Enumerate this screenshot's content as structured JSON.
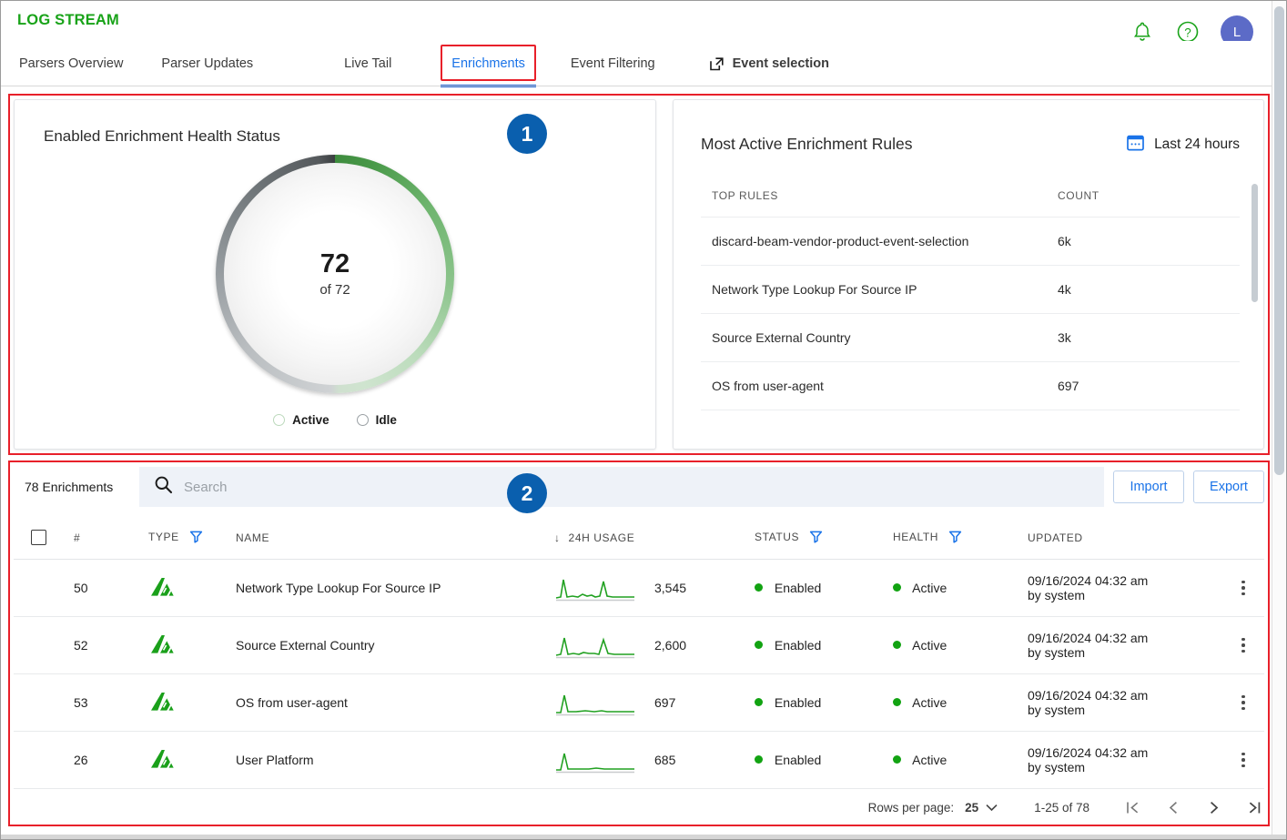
{
  "header": {
    "brand": "LOG STREAM",
    "icons": {
      "bell": "notifications-icon",
      "help": "help-icon"
    },
    "avatar_initial": "L"
  },
  "tabs": [
    {
      "label": "Parsers Overview",
      "active": false
    },
    {
      "label": "Parser Updates",
      "active": false
    },
    {
      "label": "Live Tail",
      "active": false
    },
    {
      "label": "Enrichments",
      "active": true
    },
    {
      "label": "Event Filtering",
      "active": false
    },
    {
      "label": "Event selection",
      "active": false,
      "external": true
    }
  ],
  "callouts": [
    {
      "number": "1"
    },
    {
      "number": "2"
    }
  ],
  "health_card": {
    "title": "Enabled Enrichment Health Status",
    "value": "72",
    "subtitle": "of 72",
    "legend": [
      {
        "label": "Active"
      },
      {
        "label": "Idle"
      }
    ]
  },
  "rules_card": {
    "title": "Most Active Enrichment Rules",
    "range_label": "Last 24 hours",
    "columns": [
      "TOP RULES",
      "COUNT"
    ],
    "rows": [
      {
        "rule": "discard-beam-vendor-product-event-selection",
        "count": "6k"
      },
      {
        "rule": "Network Type Lookup For Source IP",
        "count": "4k"
      },
      {
        "rule": "Source External Country",
        "count": "3k"
      },
      {
        "rule": "OS from user-agent",
        "count": "697"
      }
    ]
  },
  "toolbar": {
    "count_label": "78 Enrichments",
    "search_placeholder": "Search",
    "search_value": "",
    "import_label": "Import",
    "export_label": "Export"
  },
  "table": {
    "columns": {
      "num": "#",
      "type": "TYPE",
      "name": "NAME",
      "usage": "24H USAGE",
      "status": "STATUS",
      "health": "HEALTH",
      "updated": "UPDATED"
    },
    "rows": [
      {
        "num": "50",
        "type_icon": "enrichment-type-icon",
        "name": "Network Type Lookup For Source IP",
        "usage": "3,545",
        "status": "Enabled",
        "health": "Active",
        "updated_date": "09/16/2024 04:32 am",
        "updated_by": "by system"
      },
      {
        "num": "52",
        "type_icon": "enrichment-type-icon",
        "name": "Source External Country",
        "usage": "2,600",
        "status": "Enabled",
        "health": "Active",
        "updated_date": "09/16/2024 04:32 am",
        "updated_by": "by system"
      },
      {
        "num": "53",
        "type_icon": "enrichment-type-icon",
        "name": "OS from user-agent",
        "usage": "697",
        "status": "Enabled",
        "health": "Active",
        "updated_date": "09/16/2024 04:32 am",
        "updated_by": "by system"
      },
      {
        "num": "26",
        "type_icon": "enrichment-type-icon",
        "name": "User Platform",
        "usage": "685",
        "status": "Enabled",
        "health": "Active",
        "updated_date": "09/16/2024 04:32 am",
        "updated_by": "by system"
      }
    ]
  },
  "pagination": {
    "rows_per_page_label": "Rows per page:",
    "rows_per_page_value": "25",
    "range_label": "1-25 of 78"
  },
  "colors": {
    "brand_green": "#19a319",
    "accent_blue": "#1a73e8",
    "annotation_red": "#e8202a",
    "badge_blue": "#0a5fae",
    "status_green": "#12a312",
    "avatar_purple": "#5c6bc7"
  },
  "chart_data": {
    "type": "pie",
    "title": "Enabled Enrichment Health Status",
    "categories": [
      "Active",
      "Idle"
    ],
    "values": [
      72,
      0
    ],
    "total": 72,
    "center_value": "72",
    "center_sub": "of 72",
    "legend_position": "bottom"
  }
}
